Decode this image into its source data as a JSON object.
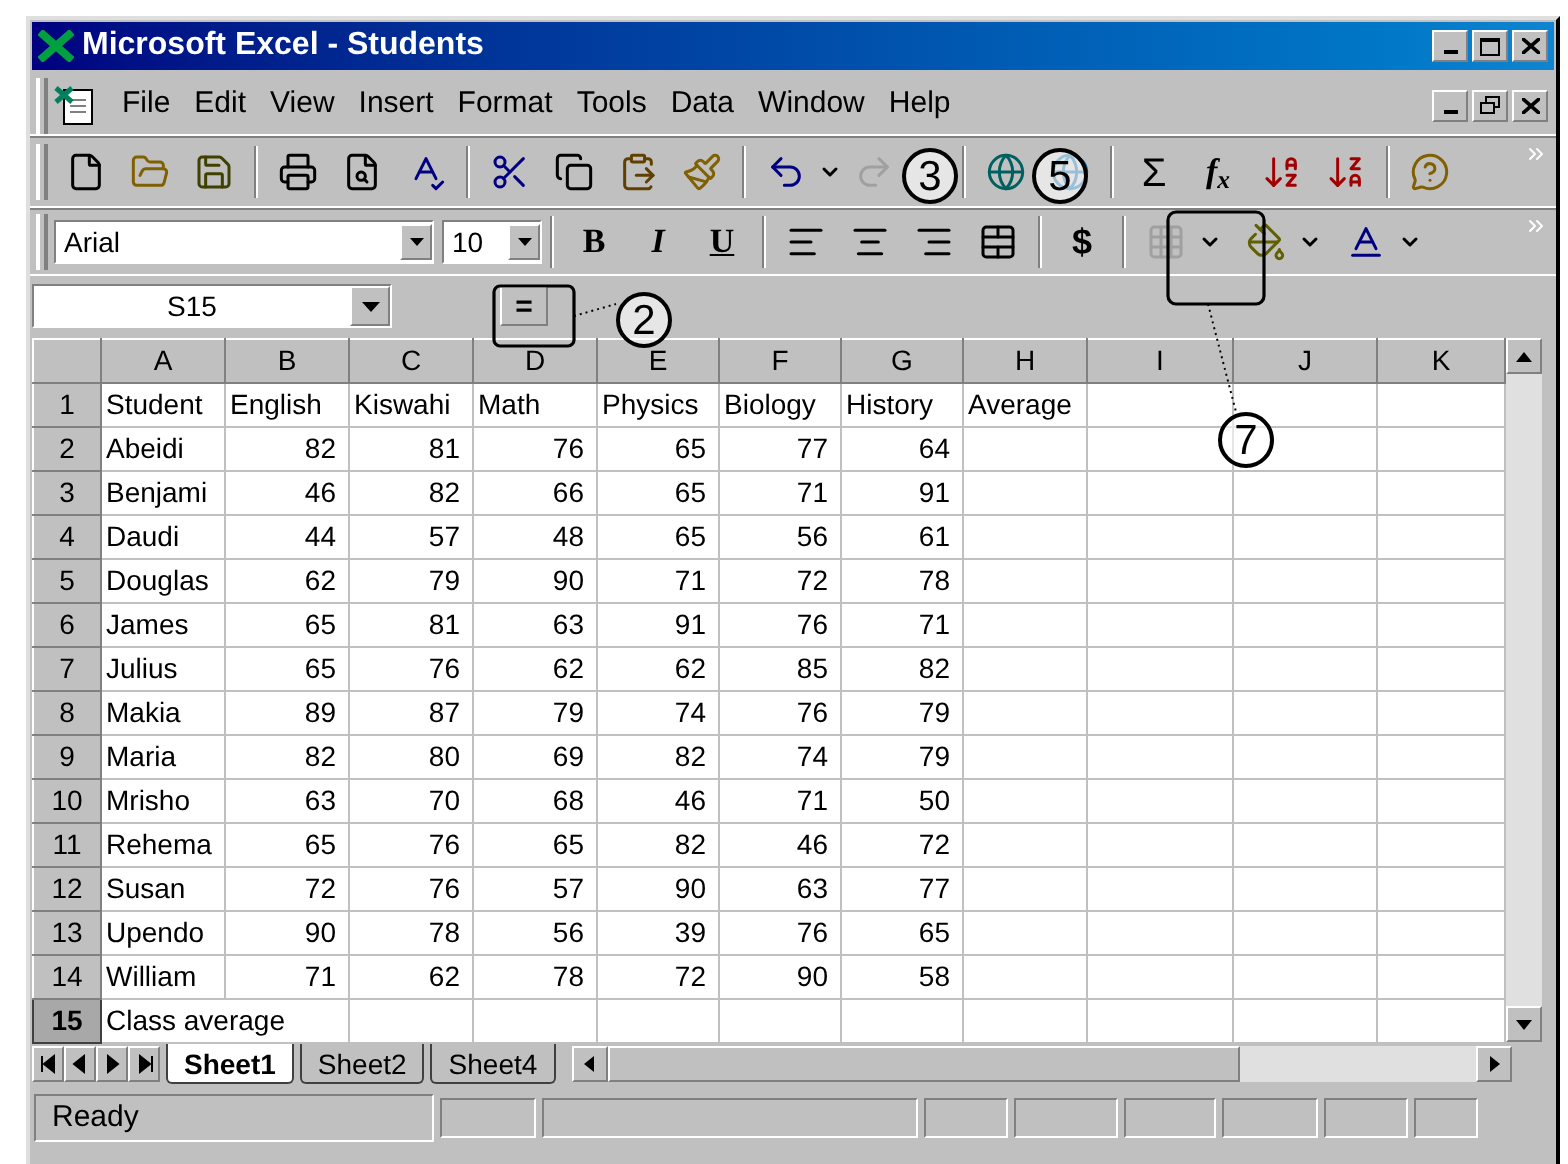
{
  "window": {
    "title": "Microsoft Excel - Students"
  },
  "menu": [
    "File",
    "Edit",
    "View",
    "Insert",
    "Format",
    "Tools",
    "Data",
    "Window",
    "Help"
  ],
  "standard_toolbar": {
    "sum": "Σ",
    "function": "f$_{x}$"
  },
  "formatting_toolbar": {
    "font": "Arial",
    "size": "10",
    "bold": "B",
    "italic": "I",
    "underline": "U",
    "currency": "$"
  },
  "formula_bar": {
    "name_box": "S15",
    "equals": "="
  },
  "columns": [
    "A",
    "B",
    "C",
    "D",
    "E",
    "F",
    "G",
    "H",
    "I",
    "J",
    "K"
  ],
  "rows": [
    {
      "number": "1",
      "kind": "header",
      "selected": false,
      "cells": [
        "Student",
        "English",
        "Kiswahi",
        "Math",
        "Physics",
        "Biology",
        "History",
        "Average"
      ]
    },
    {
      "number": "2",
      "kind": "student",
      "selected": false,
      "cells": [
        "Abeidi",
        "82",
        "81",
        "76",
        "65",
        "77",
        "64"
      ]
    },
    {
      "number": "3",
      "kind": "student",
      "selected": false,
      "cells": [
        "Benjami",
        "46",
        "82",
        "66",
        "65",
        "71",
        "91"
      ]
    },
    {
      "number": "4",
      "kind": "student",
      "selected": false,
      "cells": [
        "Daudi",
        "44",
        "57",
        "48",
        "65",
        "56",
        "61"
      ]
    },
    {
      "number": "5",
      "kind": "student",
      "selected": false,
      "cells": [
        "Douglas",
        "62",
        "79",
        "90",
        "71",
        "72",
        "78"
      ]
    },
    {
      "number": "6",
      "kind": "student",
      "selected": false,
      "cells": [
        "James",
        "65",
        "81",
        "63",
        "91",
        "76",
        "71"
      ]
    },
    {
      "number": "7",
      "kind": "student",
      "selected": false,
      "cells": [
        "Julius",
        "65",
        "76",
        "62",
        "62",
        "85",
        "82"
      ]
    },
    {
      "number": "8",
      "kind": "student",
      "selected": false,
      "cells": [
        "Makia",
        "89",
        "87",
        "79",
        "74",
        "76",
        "79"
      ]
    },
    {
      "number": "9",
      "kind": "student",
      "selected": false,
      "cells": [
        "Maria",
        "82",
        "80",
        "69",
        "82",
        "74",
        "79"
      ]
    },
    {
      "number": "10",
      "kind": "student",
      "selected": false,
      "cells": [
        "Mrisho",
        "63",
        "70",
        "68",
        "46",
        "71",
        "50"
      ]
    },
    {
      "number": "11",
      "kind": "student",
      "selected": false,
      "cells": [
        "Rehema",
        "65",
        "76",
        "65",
        "82",
        "46",
        "72"
      ]
    },
    {
      "number": "12",
      "kind": "student",
      "selected": false,
      "cells": [
        "Susan",
        "72",
        "76",
        "57",
        "90",
        "63",
        "77"
      ]
    },
    {
      "number": "13",
      "kind": "student",
      "selected": false,
      "cells": [
        "Upendo",
        "90",
        "78",
        "56",
        "39",
        "76",
        "65"
      ]
    },
    {
      "number": "14",
      "kind": "student",
      "selected": false,
      "cells": [
        "William",
        "71",
        "62",
        "78",
        "72",
        "90",
        "58"
      ]
    },
    {
      "number": "15",
      "kind": "label",
      "selected": true,
      "cells": [
        "Class average"
      ]
    }
  ],
  "sheet_tabs": [
    {
      "label": "Sheet1",
      "selected": true
    },
    {
      "label": "Sheet2",
      "selected": false
    },
    {
      "label": "Sheet4",
      "selected": false
    }
  ],
  "status_bar": {
    "text": "Ready"
  },
  "callouts": [
    {
      "label": "2"
    },
    {
      "label": "3"
    },
    {
      "label": "5"
    },
    {
      "label": "7"
    }
  ]
}
